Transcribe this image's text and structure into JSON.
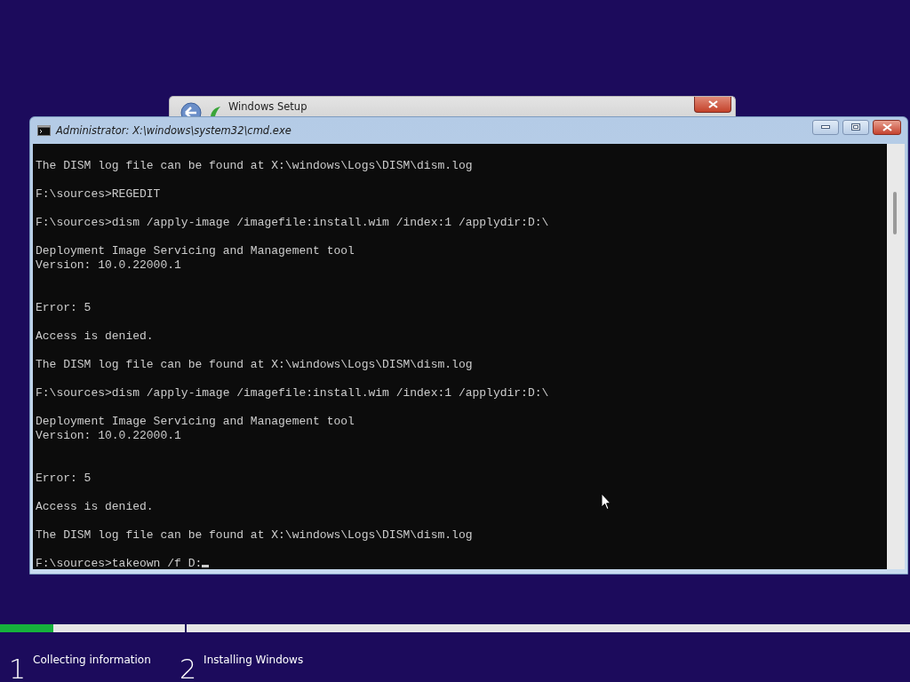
{
  "setup_window": {
    "title": "Windows Setup"
  },
  "console_window": {
    "title": "Administrator: X:\\windows\\system32\\cmd.exe"
  },
  "console": {
    "cursor": true,
    "lines": [
      {
        "kind": "text",
        "text": "The DISM log file can be found at X:\\windows\\Logs\\DISM\\dism.log"
      },
      {
        "kind": "blank"
      },
      {
        "kind": "text",
        "text": "F:\\sources>REGEDIT"
      },
      {
        "kind": "blank"
      },
      {
        "kind": "text",
        "text": "F:\\sources>dism /apply-image /imagefile:install.wim /index:1 /applydir:D:\\"
      },
      {
        "kind": "blank"
      },
      {
        "kind": "text",
        "text": "Deployment Image Servicing and Management tool"
      },
      {
        "kind": "text",
        "text": "Version: 10.0.22000.1"
      },
      {
        "kind": "blank"
      },
      {
        "kind": "blank"
      },
      {
        "kind": "text",
        "text": "Error: 5"
      },
      {
        "kind": "blank"
      },
      {
        "kind": "text",
        "text": "Access is denied."
      },
      {
        "kind": "blank"
      },
      {
        "kind": "text",
        "text": "The DISM log file can be found at X:\\windows\\Logs\\DISM\\dism.log"
      },
      {
        "kind": "blank"
      },
      {
        "kind": "text",
        "text": "F:\\sources>dism /apply-image /imagefile:install.wim /index:1 /applydir:D:\\"
      },
      {
        "kind": "blank"
      },
      {
        "kind": "text",
        "text": "Deployment Image Servicing and Management tool"
      },
      {
        "kind": "text",
        "text": "Version: 10.0.22000.1"
      },
      {
        "kind": "blank"
      },
      {
        "kind": "blank"
      },
      {
        "kind": "text",
        "text": "Error: 5"
      },
      {
        "kind": "blank"
      },
      {
        "kind": "text",
        "text": "Access is denied."
      },
      {
        "kind": "blank"
      },
      {
        "kind": "text",
        "text": "The DISM log file can be found at X:\\windows\\Logs\\DISM\\dism.log"
      },
      {
        "kind": "blank"
      },
      {
        "kind": "text",
        "text": "F:\\sources>takeown /f D:"
      }
    ]
  },
  "steps": [
    {
      "number": "1",
      "label": "Collecting information",
      "level": 0.29
    },
    {
      "number": "2",
      "label": "Installing Windows"
    }
  ]
}
